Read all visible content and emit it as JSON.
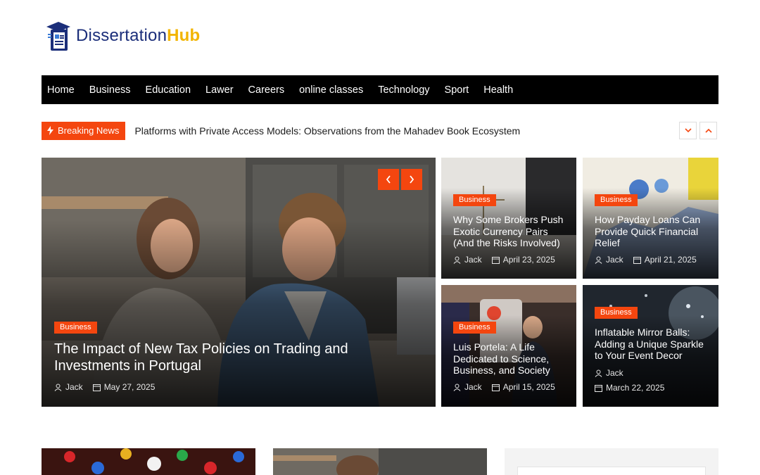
{
  "site": {
    "logo_part1": "Dissertation",
    "logo_part2": "Hub",
    "colors": {
      "accent": "#f4460f",
      "brand_blue": "#1b2e7a",
      "brand_yellow": "#f2b400",
      "nav_bg": "#000000"
    }
  },
  "nav": {
    "items": [
      "Home",
      "Business",
      "Education",
      "Lawer",
      "Careers",
      "online classes",
      "Technology",
      "Sport",
      "Health"
    ]
  },
  "breaking": {
    "label": "Breaking News",
    "headline": "Platforms with Private Access Models: Observations from the Mahadev Book Ecosystem",
    "icons": [
      "bolt-icon",
      "chevron-down-icon",
      "chevron-up-icon"
    ]
  },
  "featured": {
    "category": "Business",
    "title": "The Impact of New Tax Policies on Trading and Investments in Portugal",
    "author": "Jack",
    "date": "May 27, 2025"
  },
  "grid": [
    {
      "category": "Business",
      "title": "Why Some Brokers Push Exotic Currency Pairs (And the Risks Involved)",
      "author": "Jack",
      "date": "April 23, 2025"
    },
    {
      "category": "Business",
      "title": "How Payday Loans Can Provide Quick Financial Relief",
      "author": "Jack",
      "date": "April 21, 2025"
    },
    {
      "category": "Business",
      "title": "Luis Portela: A Life Dedicated to Science, Business, and Society",
      "author": "Jack",
      "date": "April 15, 2025"
    },
    {
      "category": "Business",
      "title": "Inflatable Mirror Balls: Adding a Unique Sparkle to Your Event Decor",
      "author": "Jack",
      "date": "March 22, 2025"
    }
  ]
}
